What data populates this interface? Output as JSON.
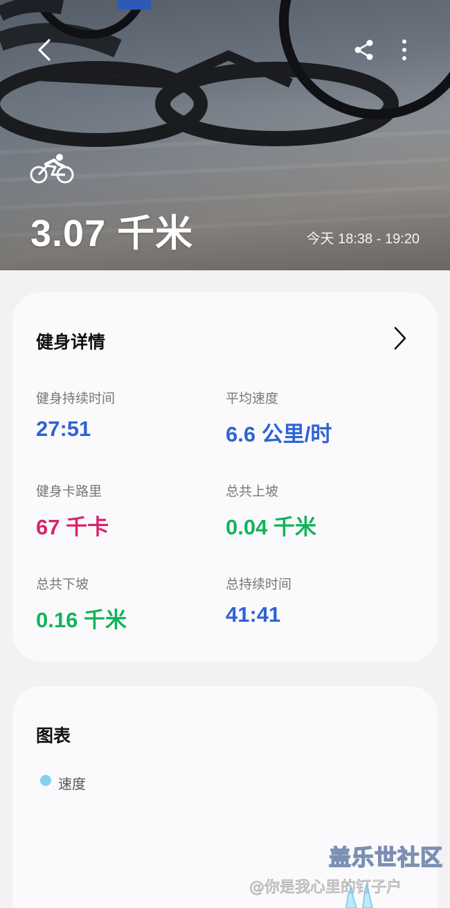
{
  "hero": {
    "distance": "3.07 千米",
    "time_range": "今天 18:38 - 19:20",
    "icons": {
      "back": "back-arrow-icon",
      "share": "share-icon",
      "more": "more-vert-icon",
      "activity": "cycling-icon"
    }
  },
  "details": {
    "title": "健身详情",
    "metrics": [
      {
        "label": "健身持续时间",
        "value": "27:51",
        "color": "#2f63d3"
      },
      {
        "label": "平均速度",
        "value": "6.6 公里/时",
        "color": "#2f63d3"
      },
      {
        "label": "健身卡路里",
        "value": "67 千卡",
        "color": "#d9236e"
      },
      {
        "label": "总共上坡",
        "value": "0.04 千米",
        "color": "#12b35a"
      },
      {
        "label": "总共下坡",
        "value": "0.16 千米",
        "color": "#12b35a"
      },
      {
        "label": "总持续时间",
        "value": "41:41",
        "color": "#2f63d3"
      }
    ]
  },
  "chart": {
    "title": "图表",
    "legend": {
      "label": "速度",
      "color": "#7fd3f0"
    }
  },
  "watermark": {
    "title": "盖乐世社区",
    "subtitle": "@你是我心里的钉子户"
  }
}
